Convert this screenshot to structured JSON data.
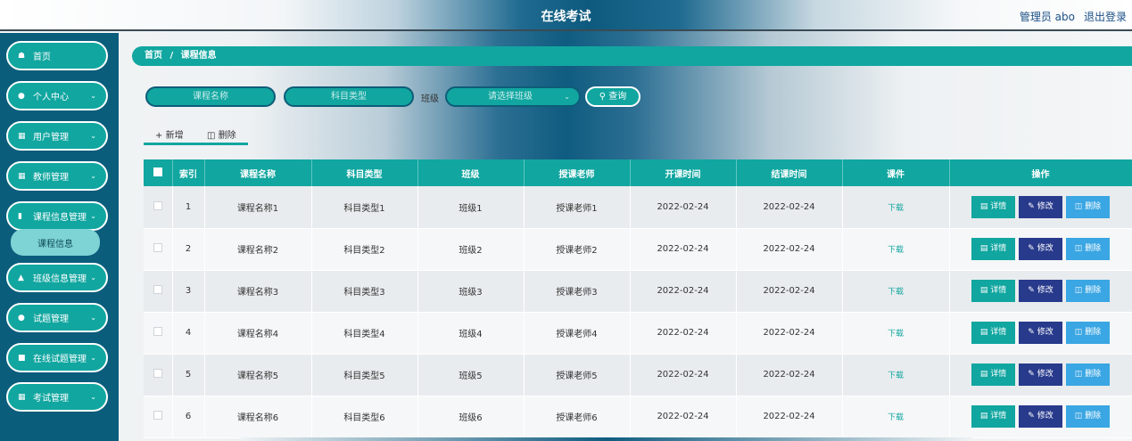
{
  "header": {
    "title": "在线考试",
    "user": "管理员 abo",
    "logout": "退出登录"
  },
  "sidebar": {
    "items": [
      {
        "label": "首页",
        "icon": "home-icon"
      },
      {
        "label": "个人中心",
        "icon": "person-icon"
      },
      {
        "label": "用户管理",
        "icon": "grid-icon"
      },
      {
        "label": "教师管理",
        "icon": "grid-icon"
      },
      {
        "label": "课程信息管理",
        "icon": "clipboard-icon"
      },
      {
        "label": "班级信息管理",
        "icon": "thumb-icon"
      },
      {
        "label": "试题管理",
        "icon": "pin-icon"
      },
      {
        "label": "在线试题管理",
        "icon": "square-icon"
      },
      {
        "label": "考试管理",
        "icon": "grid-icon"
      }
    ],
    "sub_item": "课程信息"
  },
  "breadcrumb": {
    "home": "首页",
    "sep": "/",
    "current": "课程信息"
  },
  "search": {
    "course_placeholder": "课程名称",
    "subject_placeholder": "科目类型",
    "class_label": "班级",
    "class_placeholder": "请选择班级",
    "query": "查询"
  },
  "actions": {
    "add": "新增",
    "delete": "删除"
  },
  "table": {
    "headers": [
      "索引",
      "课程名称",
      "科目类型",
      "班级",
      "授课老师",
      "开课时间",
      "结课时间",
      "课件",
      "操作"
    ],
    "rows": [
      {
        "index": "1",
        "name": "课程名称1",
        "subject": "科目类型1",
        "class": "班级1",
        "teacher": "授课老师1",
        "start": "2022-02-24",
        "end": "2022-02-24",
        "file": "下载"
      },
      {
        "index": "2",
        "name": "课程名称2",
        "subject": "科目类型2",
        "class": "班级2",
        "teacher": "授课老师2",
        "start": "2022-02-24",
        "end": "2022-02-24",
        "file": "下载"
      },
      {
        "index": "3",
        "name": "课程名称3",
        "subject": "科目类型3",
        "class": "班级3",
        "teacher": "授课老师3",
        "start": "2022-02-24",
        "end": "2022-02-24",
        "file": "下载"
      },
      {
        "index": "4",
        "name": "课程名称4",
        "subject": "科目类型4",
        "class": "班级4",
        "teacher": "授课老师4",
        "start": "2022-02-24",
        "end": "2022-02-24",
        "file": "下载"
      },
      {
        "index": "5",
        "name": "课程名称5",
        "subject": "科目类型5",
        "class": "班级5",
        "teacher": "授课老师5",
        "start": "2022-02-24",
        "end": "2022-02-24",
        "file": "下载"
      },
      {
        "index": "6",
        "name": "课程名称6",
        "subject": "科目类型6",
        "class": "班级6",
        "teacher": "授课老师6",
        "start": "2022-02-24",
        "end": "2022-02-24",
        "file": "下载"
      }
    ],
    "btn_detail": "详情",
    "btn_edit": "修改",
    "btn_delete": "删除"
  },
  "colors": {
    "accent": "#11a6a0",
    "sidebar": "#0b5d7c",
    "edit": "#283a8c",
    "delete": "#3aa6e3"
  }
}
